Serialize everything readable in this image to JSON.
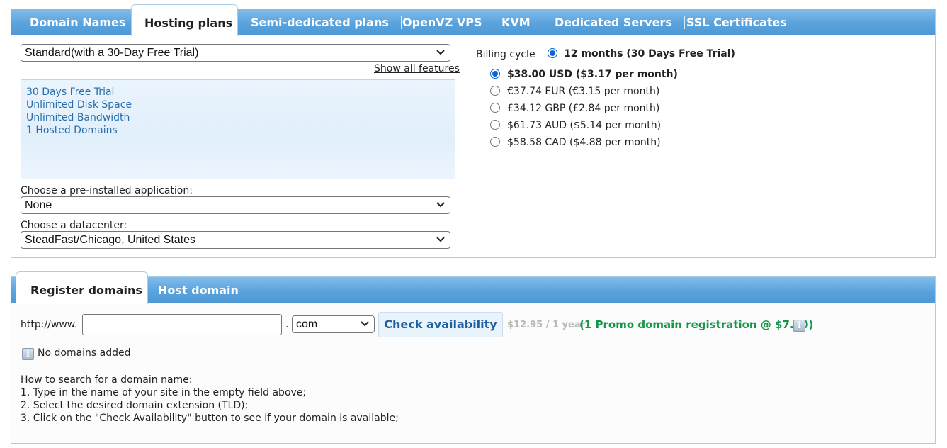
{
  "tabs": [
    {
      "label": "Domain Names",
      "active": false
    },
    {
      "label": "Hosting plans",
      "active": true
    },
    {
      "label": "Semi-dedicated plans",
      "active": false
    },
    {
      "label": "OpenVZ VPS",
      "active": false
    },
    {
      "label": "KVM",
      "active": false
    },
    {
      "label": "Dedicated Servers",
      "active": false
    },
    {
      "label": "SSL Certificates",
      "active": false
    }
  ],
  "plan": {
    "selected": "Standard(with a 30-Day Free Trial)",
    "show_all_features": "Show all features",
    "features": [
      "30 Days Free Trial",
      "Unlimited Disk Space",
      "Unlimited Bandwidth",
      "1 Hosted Domains"
    ],
    "app_label": "Choose a pre-installed application:",
    "app_value": "None",
    "dc_label": "Choose a datacenter:",
    "dc_value": "SteadFast/Chicago, United States"
  },
  "billing": {
    "label": "Billing cycle",
    "cycle": "12 months (30 Days Free Trial)",
    "prices": [
      {
        "text": "$38.00 USD ($3.17 per month)",
        "selected": true
      },
      {
        "text": "€37.74 EUR (€3.15 per month)",
        "selected": false
      },
      {
        "text": "£34.12 GBP (£2.84 per month)",
        "selected": false
      },
      {
        "text": "$61.73 AUD ($5.14 per month)",
        "selected": false
      },
      {
        "text": "$58.58 CAD ($4.88 per month)",
        "selected": false
      }
    ]
  },
  "domain_tabs": [
    {
      "label": "Register domains",
      "active": true
    },
    {
      "label": "Host domain",
      "active": false
    }
  ],
  "domain": {
    "prefix": "http://www.",
    "input_value": "",
    "dot": ".",
    "tld": "com",
    "check_label": "Check availability",
    "old_price": "$12.95 / 1 year",
    "promo": "(1 Promo domain registration @ $7.00)",
    "no_domains": "No domains added",
    "howto_title": "How to search for a domain name:",
    "steps": [
      "1. Type in the name of your site in the empty field above;",
      "2. Select the desired domain extension (TLD);",
      "3. Click on the \"Check Availability\" button to see if your domain is available;"
    ]
  },
  "colors": {
    "tab_blue": "#5aa3dd",
    "feature_text": "#2a6eab",
    "promo_green": "#14964a",
    "button_text": "#1d5fa0"
  },
  "icons": {
    "select_arrow": "chevron-down-icon",
    "info": "info-icon"
  }
}
